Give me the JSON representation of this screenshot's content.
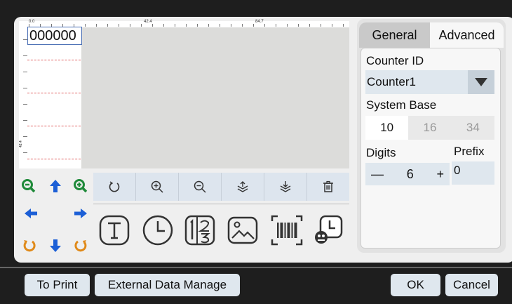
{
  "canvas": {
    "counter_text": "000000",
    "ruler_top_labels": [
      "0.0",
      "42.4",
      "84.7"
    ],
    "ruler_left_label": "42.4"
  },
  "toolbar": {
    "icons": [
      "rotate-icon",
      "zoom-in-icon",
      "zoom-out-icon",
      "layer-up-icon",
      "layer-down-icon",
      "trash-icon"
    ]
  },
  "navigation": {
    "icons": [
      "zoom-out-icon",
      "arrow-up-icon",
      "zoom-in-icon",
      "arrow-left-icon",
      "arrow-right-icon",
      "rotate-left-icon",
      "arrow-down-icon",
      "rotate-right-icon"
    ],
    "colors": {
      "green": "#1f8a3a",
      "blue": "#1c5fd6",
      "orange": "#e08a1a"
    }
  },
  "objects": {
    "icons": [
      "text-object-icon",
      "clock-object-icon",
      "counter-object-icon",
      "image-object-icon",
      "barcode-object-icon",
      "shift-object-icon"
    ]
  },
  "panel": {
    "tabs": [
      "General",
      "Advanced"
    ],
    "active_tab": "Advanced",
    "counter_id_label": "Counter ID",
    "counter_id_value": "Counter1",
    "system_base_label": "System Base",
    "system_base_options": [
      "10",
      "16",
      "34"
    ],
    "system_base_selected": "10",
    "digits_label": "Digits",
    "digits_value": "6",
    "digits_minus": "—",
    "digits_plus": "+",
    "prefix_label": "Prefix",
    "prefix_value": "0"
  },
  "buttons": {
    "to_print": "To Print",
    "external_data": "External Data Manage",
    "ok": "OK",
    "cancel": "Cancel"
  }
}
